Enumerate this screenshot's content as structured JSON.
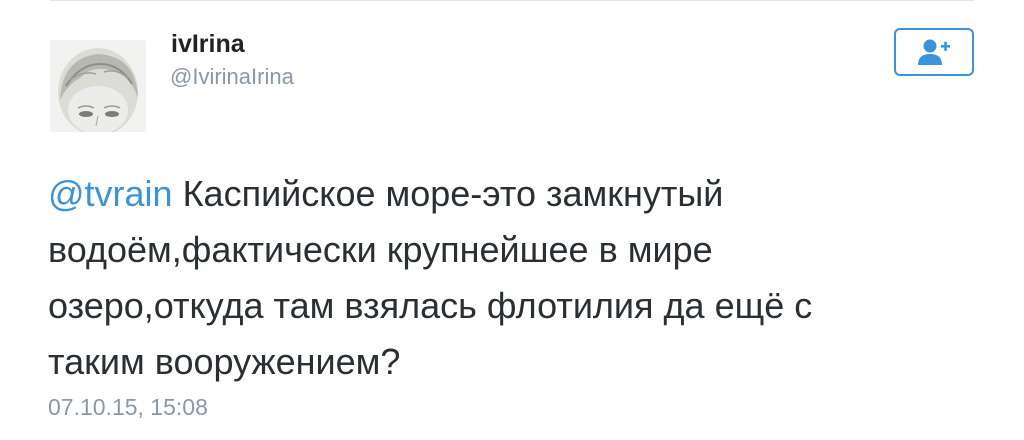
{
  "user": {
    "display_name": "ivIrina",
    "handle": "@IvirinaIrina"
  },
  "follow_button": {
    "icon": "add-user-icon"
  },
  "tweet": {
    "mention": "@tvrain",
    "line1_rest": " Каспийское море-это замкнутый",
    "line2": "водоём,фактически крупнейшее в мире",
    "line3": "озеро,откуда там взялась флотилия да ещё с",
    "line4": "таким вооружением?"
  },
  "timestamp": "07.10.15, 15:08",
  "colors": {
    "accent": "#3b94d9",
    "text": "#292f33",
    "muted": "#8899a6"
  }
}
